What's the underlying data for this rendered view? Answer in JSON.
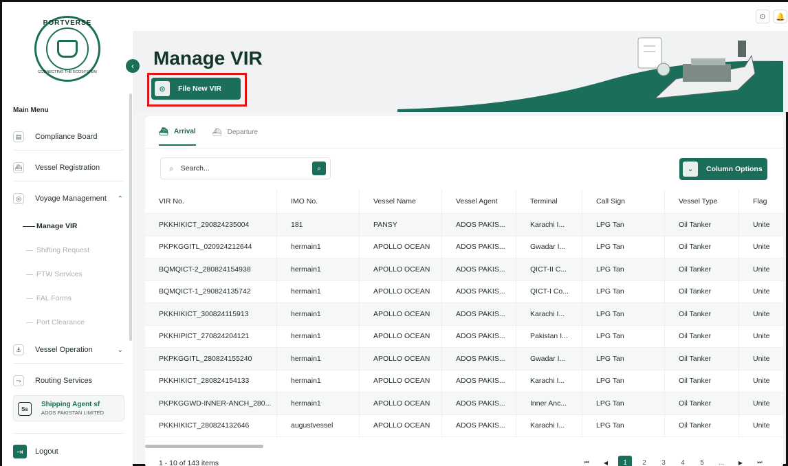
{
  "brand": {
    "name": "PORTVERSE",
    "tagline": "CONNECTING THE ECOSYSTEM"
  },
  "sidebar": {
    "heading": "Main Menu",
    "items": [
      {
        "label": "Compliance Board",
        "icon": "document-icon"
      },
      {
        "label": "Vessel Registration",
        "icon": "ship-icon"
      },
      {
        "label": "Voyage Management",
        "icon": "voyage-icon",
        "expanded": true
      },
      {
        "label": "Vessel Operation",
        "icon": "operation-icon"
      },
      {
        "label": "Routing Services",
        "icon": "routing-icon"
      }
    ],
    "subitems": [
      {
        "label": "Manage VIR",
        "active": true
      },
      {
        "label": "Shifting Request"
      },
      {
        "label": "PTW Services"
      },
      {
        "label": "FAL Forms"
      },
      {
        "label": "Port Clearance"
      }
    ],
    "user": {
      "initials": "Ss",
      "name": "Shipping Agent sf",
      "company": "ADOS PAKISTAN LIMITED"
    },
    "logout": "Logout"
  },
  "page": {
    "title": "Manage VIR",
    "file_button": "File New VIR"
  },
  "tabs": [
    {
      "label": "Arrival",
      "active": true
    },
    {
      "label": "Departure"
    }
  ],
  "search": {
    "placeholder": "Search..."
  },
  "column_options": "Column Options",
  "table": {
    "headers": [
      "VIR No.",
      "IMO No.",
      "Vessel Name",
      "Vessel Agent",
      "Terminal",
      "Call Sign",
      "Vessel Type",
      "Flag"
    ],
    "rows": [
      [
        "PKKHIKICT_290824235004",
        "181",
        "PANSY",
        "ADOS PAKIS...",
        "Karachi I...",
        "LPG Tan",
        "Oil Tanker",
        "Unite"
      ],
      [
        "PKPKGGITL_020924212644",
        "hermain1",
        "APOLLO OCEAN",
        "ADOS PAKIS...",
        "Gwadar I...",
        "LPG Tan",
        "Oil Tanker",
        "Unite"
      ],
      [
        "BQMQICT-2_280824154938",
        "hermain1",
        "APOLLO OCEAN",
        "ADOS PAKIS...",
        "QICT-II C...",
        "LPG Tan",
        "Oil Tanker",
        "Unite"
      ],
      [
        "BQMQICT-1_290824135742",
        "hermain1",
        "APOLLO OCEAN",
        "ADOS PAKIS...",
        "QICT-I Co...",
        "LPG Tan",
        "Oil Tanker",
        "Unite"
      ],
      [
        "PKKHIKICT_300824115913",
        "hermain1",
        "APOLLO OCEAN",
        "ADOS PAKIS...",
        "Karachi I...",
        "LPG Tan",
        "Oil Tanker",
        "Unite"
      ],
      [
        "PKKHIPICT_270824204121",
        "hermain1",
        "APOLLO OCEAN",
        "ADOS PAKIS...",
        "Pakistan I...",
        "LPG Tan",
        "Oil Tanker",
        "Unite"
      ],
      [
        "PKPKGGITL_280824155240",
        "hermain1",
        "APOLLO OCEAN",
        "ADOS PAKIS...",
        "Gwadar I...",
        "LPG Tan",
        "Oil Tanker",
        "Unite"
      ],
      [
        "PKKHIKICT_280824154133",
        "hermain1",
        "APOLLO OCEAN",
        "ADOS PAKIS...",
        "Karachi I...",
        "LPG Tan",
        "Oil Tanker",
        "Unite"
      ],
      [
        "PKPKGGWD-INNER-ANCH_280...",
        "hermain1",
        "APOLLO OCEAN",
        "ADOS PAKIS...",
        "Inner Anc...",
        "LPG Tan",
        "Oil Tanker",
        "Unite"
      ],
      [
        "PKKHIKICT_280824132646",
        "augustvessel",
        "APOLLO OCEAN",
        "ADOS PAKIS...",
        "Karachi I...",
        "LPG Tan",
        "Oil Tanker",
        "Unite"
      ]
    ]
  },
  "pagination": {
    "summary": "1 - 10 of 143 items",
    "pages": [
      "1",
      "2",
      "3",
      "4",
      "5",
      "..."
    ],
    "current": "1"
  },
  "colors": {
    "primary": "#1a6e5a",
    "highlight": "#e01414"
  }
}
